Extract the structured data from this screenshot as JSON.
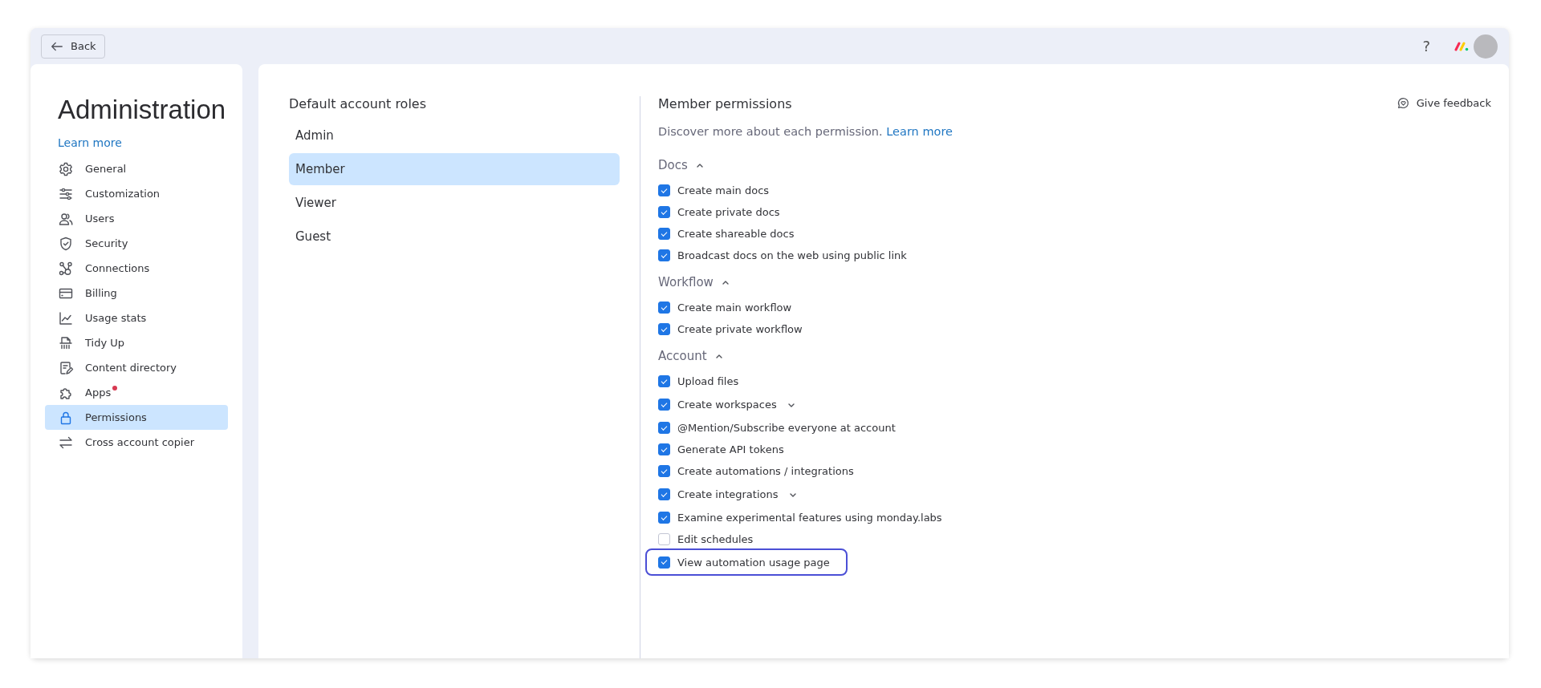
{
  "top_bar": {
    "back_button": "Back",
    "help": "?"
  },
  "sidebar": {
    "title": "Administration",
    "learn_more": "Learn more",
    "items": [
      {
        "label": "General",
        "selected": false,
        "dot": false
      },
      {
        "label": "Customization",
        "selected": false,
        "dot": false
      },
      {
        "label": "Users",
        "selected": false,
        "dot": false
      },
      {
        "label": "Security",
        "selected": false,
        "dot": false
      },
      {
        "label": "Connections",
        "selected": false,
        "dot": false
      },
      {
        "label": "Billing",
        "selected": false,
        "dot": false
      },
      {
        "label": "Usage stats",
        "selected": false,
        "dot": false
      },
      {
        "label": "Tidy Up",
        "selected": false,
        "dot": false
      },
      {
        "label": "Content directory",
        "selected": false,
        "dot": false
      },
      {
        "label": "Apps",
        "selected": false,
        "dot": true
      },
      {
        "label": "Permissions",
        "selected": true,
        "dot": false
      },
      {
        "label": "Cross account copier",
        "selected": false,
        "dot": false
      }
    ]
  },
  "roles": {
    "title": "Default account roles",
    "items": [
      {
        "label": "Admin",
        "selected": false
      },
      {
        "label": "Member",
        "selected": true
      },
      {
        "label": "Viewer",
        "selected": false
      },
      {
        "label": "Guest",
        "selected": false
      }
    ]
  },
  "permissions": {
    "title": "Member permissions",
    "intro": "Discover more about each permission.",
    "learn_more": "Learn more",
    "give_feedback": "Give feedback",
    "sections": [
      {
        "title": "Docs",
        "expanded": true,
        "rows": [
          {
            "label": "Create main docs",
            "checked": true,
            "kind": "plain",
            "highlighted": false
          },
          {
            "label": "Create private docs",
            "checked": true,
            "kind": "plain",
            "highlighted": false
          },
          {
            "label": "Create shareable docs",
            "checked": true,
            "kind": "plain",
            "highlighted": false
          },
          {
            "label": "Broadcast docs on the web using public link",
            "checked": true,
            "kind": "plain",
            "highlighted": false
          }
        ]
      },
      {
        "title": "Workflow",
        "expanded": true,
        "rows": [
          {
            "label": "Create main workflow",
            "checked": true,
            "kind": "plain",
            "highlighted": false
          },
          {
            "label": "Create private workflow",
            "checked": true,
            "kind": "plain",
            "highlighted": false
          }
        ]
      },
      {
        "title": "Account",
        "expanded": true,
        "rows": [
          {
            "label": "Upload files",
            "checked": true,
            "kind": "plain",
            "highlighted": false
          },
          {
            "label": "Create workspaces",
            "checked": true,
            "kind": "expandable",
            "highlighted": false
          },
          {
            "label": "@Mention/Subscribe everyone at account",
            "checked": true,
            "kind": "plain",
            "highlighted": false
          },
          {
            "label": "Generate API tokens",
            "checked": true,
            "kind": "plain",
            "highlighted": false
          },
          {
            "label": "Create automations / integrations",
            "checked": true,
            "kind": "plain",
            "highlighted": false
          },
          {
            "label": "Create integrations",
            "checked": true,
            "kind": "expandable",
            "highlighted": false
          },
          {
            "label": "Examine experimental features using monday.labs",
            "checked": true,
            "kind": "plain",
            "highlighted": false
          },
          {
            "label": "Edit schedules",
            "checked": false,
            "kind": "plain",
            "highlighted": false
          },
          {
            "label": "View automation usage page",
            "checked": true,
            "kind": "plain",
            "highlighted": true
          }
        ]
      }
    ]
  }
}
